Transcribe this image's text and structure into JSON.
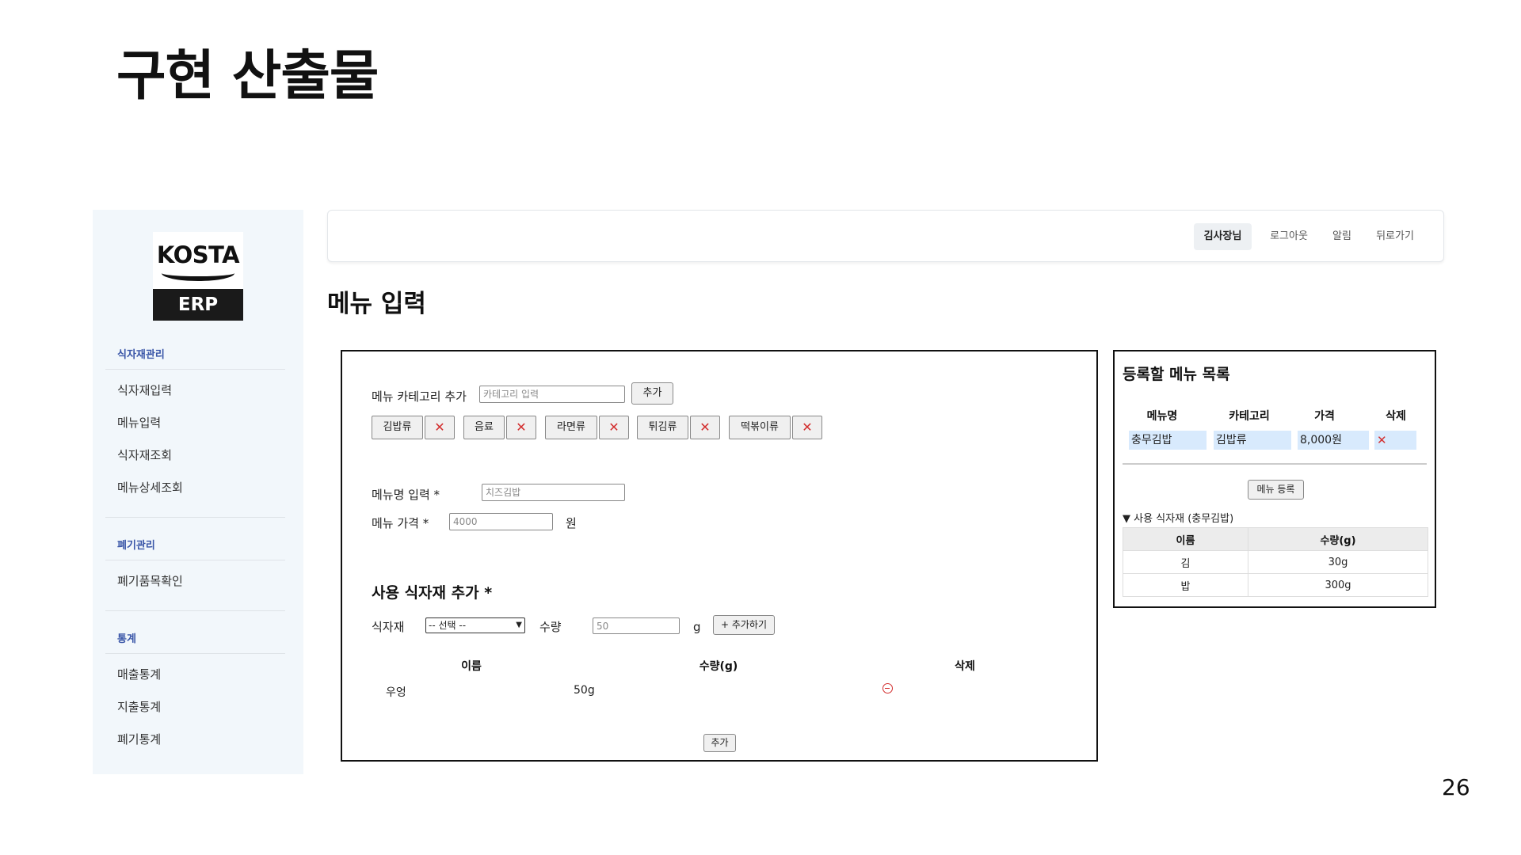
{
  "slide": {
    "title": "구현 산출물",
    "page_number": "26"
  },
  "logo": {
    "top": "KOSTA",
    "bottom": "ERP"
  },
  "sidebar": {
    "sections": [
      {
        "header": "식자재관리",
        "items": [
          "식자재입력",
          "메뉴입력",
          "식자재조회",
          "메뉴상세조회"
        ]
      },
      {
        "header": "폐기관리",
        "items": [
          "폐기품목확인"
        ]
      },
      {
        "header": "통계",
        "items": [
          "매출통계",
          "지출통계",
          "폐기통계"
        ]
      }
    ]
  },
  "topbar": {
    "user": "김사장님",
    "logout": "로그아웃",
    "alarm": "알림",
    "back": "뒤로가기"
  },
  "page": {
    "heading": "메뉴 입력"
  },
  "form": {
    "category_label": "메뉴 카테고리 추가",
    "category_placeholder": "카테고리 입력",
    "category_add": "추가",
    "categories": [
      "김밥류",
      "음료",
      "라면류",
      "튀김류",
      "떡볶이류"
    ],
    "delete_symbol": "✕",
    "menu_name_label": "메뉴명 입력 *",
    "menu_name_placeholder": "치즈김밥",
    "menu_price_label": "메뉴 가격 *",
    "menu_price_placeholder": "4000",
    "price_unit": "원",
    "ingredient_section_title": "사용 식자재 추가 *",
    "ingredient_label": "식자재",
    "ingredient_select": "-- 선택 --",
    "quantity_label": "수량",
    "quantity_placeholder": "50",
    "quantity_unit": "g",
    "add_ingredient_button": "+ 추가하기",
    "table_headers": {
      "name": "이름",
      "quantity": "수량(g)",
      "delete": "삭제"
    },
    "ingredients": [
      {
        "name": "우엉",
        "quantity": "50g"
      }
    ],
    "submit_button": "추가"
  },
  "menu_list": {
    "title": "등록할 메뉴 목록",
    "headers": {
      "name": "메뉴명",
      "category": "카테고리",
      "price": "가격",
      "delete": "삭제"
    },
    "rows": [
      {
        "name": "충무김밥",
        "category": "김밥류",
        "price": "8,000원"
      }
    ],
    "register_button": "메뉴 등록",
    "detail_title": "▼ 사용 식자재 (충무김밥)",
    "detail_headers": {
      "name": "이름",
      "quantity": "수량(g)"
    },
    "detail_rows": [
      {
        "name": "김",
        "quantity": "30g"
      },
      {
        "name": "밥",
        "quantity": "300g"
      }
    ]
  },
  "colors": {
    "nav_header": "#3a56a8",
    "delete": "#d32f2f",
    "row_highlight": "#d8eafd",
    "sidebar_bg": "#f2f7fb"
  }
}
